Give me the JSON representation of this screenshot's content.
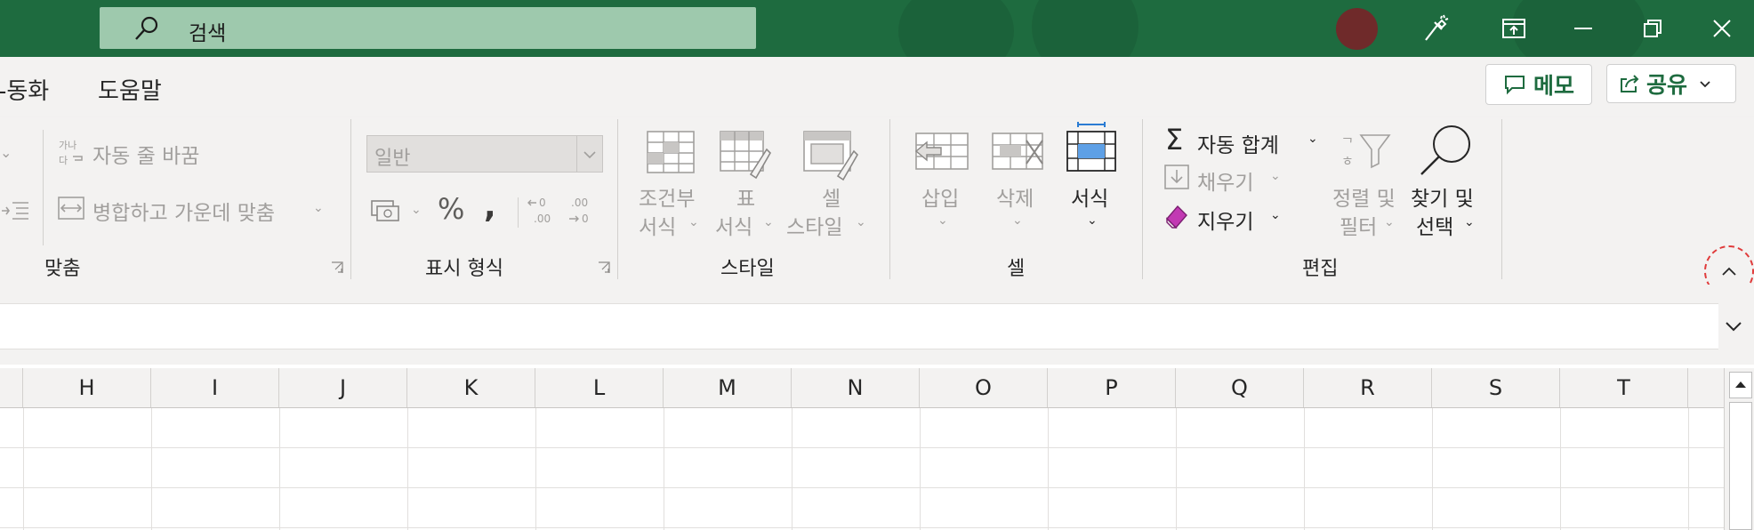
{
  "titlebar": {
    "search_placeholder": "검색",
    "accent_color": "#1e6b3f"
  },
  "tabs": [
    "-동화",
    "도움말"
  ],
  "actions": {
    "memo_label": "메모",
    "share_label": "공유"
  },
  "ribbon": {
    "alignment": {
      "wrap_text": "자동 줄 바꿈",
      "merge_center": "병합하고 가운데 맞춤",
      "label": "맞춤"
    },
    "number": {
      "format_value": "일반",
      "percent": "%",
      "comma": ",",
      "label": "표시 형식"
    },
    "styles": {
      "conditional_line1": "조건부",
      "conditional_line2": "서식",
      "table_line1": "표",
      "table_line2": "서식",
      "cell_line1": "셀",
      "cell_line2": "스타일",
      "label": "스타일"
    },
    "cells": {
      "insert": "삽입",
      "delete": "삭제",
      "format": "서식",
      "label": "셀"
    },
    "editing": {
      "autosum": "자동 합계",
      "fill": "채우기",
      "clear": "지우기",
      "sort_line1": "정렬 및",
      "sort_line2": "필터",
      "find_line1": "찾기 및",
      "find_line2": "선택",
      "label": "편집"
    }
  },
  "grid": {
    "columns": [
      "H",
      "I",
      "J",
      "K",
      "L",
      "M",
      "N",
      "O",
      "P",
      "Q",
      "R",
      "S",
      "T"
    ]
  }
}
